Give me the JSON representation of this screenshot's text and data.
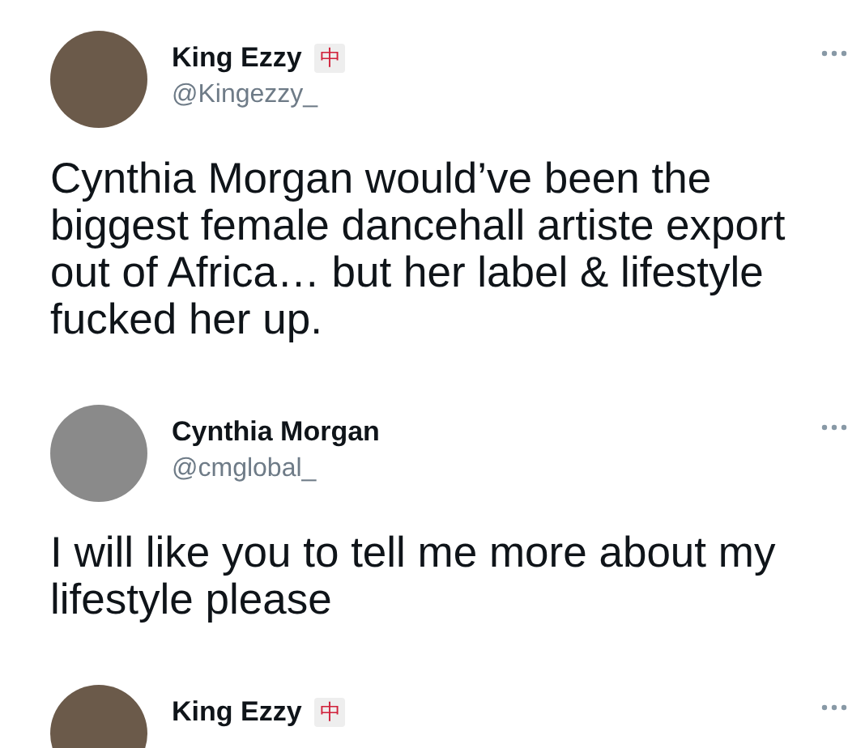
{
  "tweets": [
    {
      "name": "King Ezzy",
      "badge": "中",
      "handle": "@Kingezzy_",
      "text": "Cynthia Morgan would’ve been the biggest female dancehall artiste export out of Africa… but her label & lifestyle fucked her up."
    },
    {
      "name": "Cynthia Morgan",
      "handle": "@cmglobal_",
      "text": "I will like you to tell me more about my lifestyle please"
    },
    {
      "name": "King Ezzy",
      "badge": "中"
    }
  ]
}
